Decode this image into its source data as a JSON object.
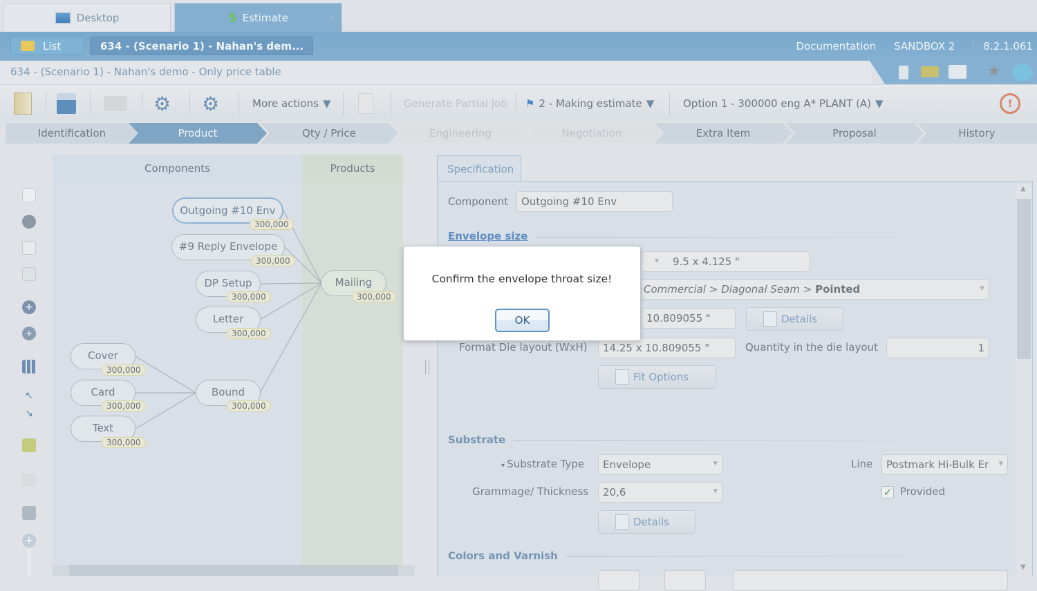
{
  "tabs": [
    {
      "label": "Desktop",
      "icon": "monitor-icon"
    },
    {
      "label": "Estimate",
      "icon": "dollar-document-icon",
      "close": "x"
    }
  ],
  "header": {
    "list_label": "List",
    "doc_tab": "634 - (Scenario 1) - Nahan's dem...",
    "doc_close": "x",
    "links": [
      "Documentation",
      "SANDBOX 2",
      "8.2.1.061"
    ]
  },
  "breadcrumb": "634 - (Scenario 1) - Nahan's demo - Only price table",
  "toolbar": {
    "more_actions": "More actions",
    "generate_partial_job": "Generate Partial Job",
    "status": "2 - Making estimate",
    "option": "Option 1 - 300000 eng A* PLANT (A)"
  },
  "steps": [
    {
      "label": "Identification",
      "state": "normal"
    },
    {
      "label": "Product",
      "state": "active"
    },
    {
      "label": "Qty / Price",
      "state": "normal"
    },
    {
      "label": "Engineering",
      "state": "disabled"
    },
    {
      "label": "Negotiation",
      "state": "disabled"
    },
    {
      "label": "Extra Item",
      "state": "normal"
    },
    {
      "label": "Proposal",
      "state": "normal"
    },
    {
      "label": "History",
      "state": "normal"
    }
  ],
  "tree": {
    "components_header": "Components",
    "products_header": "Products",
    "nodes": [
      {
        "label": "Outgoing #10 Env",
        "qty": "300,000"
      },
      {
        "label": "#9 Reply Envelope",
        "qty": "300,000"
      },
      {
        "label": "DP Setup",
        "qty": "300,000"
      },
      {
        "label": "Letter",
        "qty": "300,000"
      },
      {
        "label": "Cover",
        "qty": "300,000"
      },
      {
        "label": "Card",
        "qty": "300,000"
      },
      {
        "label": "Text",
        "qty": "300,000"
      },
      {
        "label": "Bound",
        "qty": "300,000"
      },
      {
        "label": "Mailing",
        "qty": "300,000"
      }
    ]
  },
  "spec": {
    "tab": "Specification",
    "component_label": "Component",
    "component_value": "Outgoing #10 Env",
    "envelope_size": "Envelope size",
    "size_value": "9.5 x 4.125 \"",
    "style_path": [
      "Commercial",
      "Diagonal Seam",
      "Pointed"
    ],
    "dim_value": "10.809055 \"",
    "details": "Details",
    "die_label": "Format Die layout (WxH)",
    "die_value": "14.25 x 10.809055 \"",
    "qty_die_label": "Quantity in the die layout",
    "qty_die_value": "1",
    "fit_options": "Fit Options",
    "substrate": "Substrate",
    "substrate_type_label": "Substrate Type",
    "substrate_type": "Envelope",
    "line_label": "Line",
    "line_value": "Postmark Hi-Bulk Er",
    "grammage_label": "Grammage/ Thickness",
    "grammage_value": "20,6",
    "provided": "Provided",
    "provided_checked": true,
    "substrate_details": "Details",
    "colors": "Colors and Varnish"
  },
  "modal": {
    "message": "Confirm the envelope throat size!",
    "ok": "OK"
  }
}
